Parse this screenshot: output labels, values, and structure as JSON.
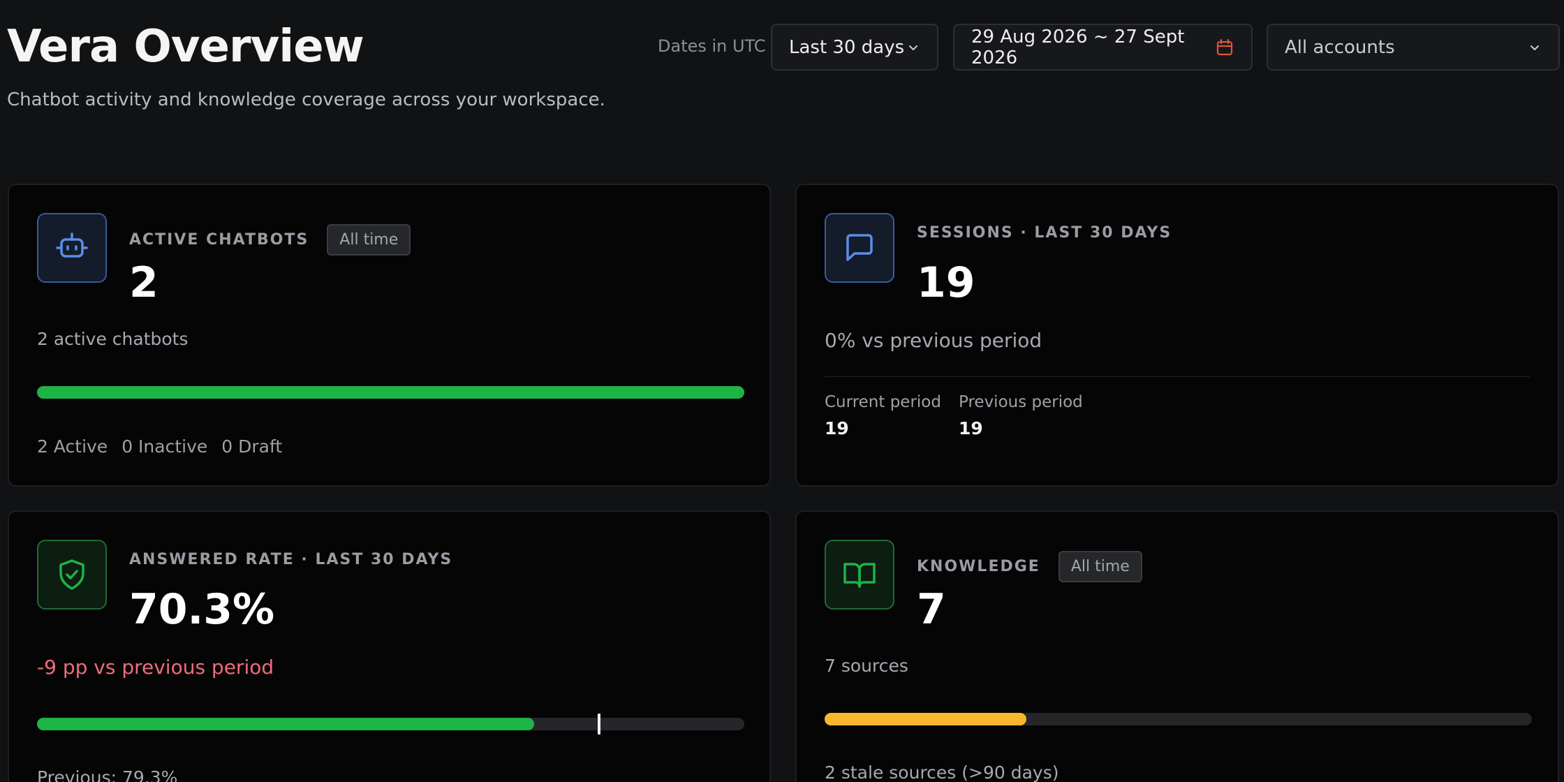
{
  "header": {
    "title": "Vera Overview",
    "subtitle": "Chatbot activity and knowledge coverage across your workspace.",
    "dates_label": "Dates in UTC",
    "range_select": "Last 30 days",
    "date_range": "29 Aug 2026 ~ 27 Sept 2026",
    "account_select": "All accounts"
  },
  "colors": {
    "accent_blue": "#5b8ee6",
    "green": "#1db446",
    "yellow": "#fbb72c",
    "negative": "#f06c7a",
    "calendar_icon": "#e0553a"
  },
  "cards": {
    "active_chatbots": {
      "icon": "robot-icon",
      "label": "ACTIVE CHATBOTS",
      "badge": "All time",
      "value": "2",
      "description": "2 active chatbots",
      "progress_fraction": 1.0,
      "stats": [
        "2 Active",
        "0 Inactive",
        "0 Draft"
      ]
    },
    "sessions": {
      "icon": "message-icon",
      "label": "SESSIONS · LAST 30 DAYS",
      "value": "19",
      "change": "0% vs previous period",
      "current_label": "Current period",
      "current_value": "19",
      "previous_label": "Previous period",
      "previous_value": "19"
    },
    "answered_rate": {
      "icon": "shield-check-icon",
      "label": "ANSWERED RATE · LAST 30 DAYS",
      "value": "70.3%",
      "change": "-9 pp vs previous period",
      "progress_fraction": 0.703,
      "previous_fraction": 0.793,
      "previous_text": "Previous: 79.3%"
    },
    "knowledge": {
      "icon": "book-open-icon",
      "label": "KNOWLEDGE",
      "badge": "All time",
      "value": "7",
      "description": "7 sources",
      "stale_fraction": 0.2857,
      "stale_text": "2 stale sources (>90 days)"
    }
  }
}
